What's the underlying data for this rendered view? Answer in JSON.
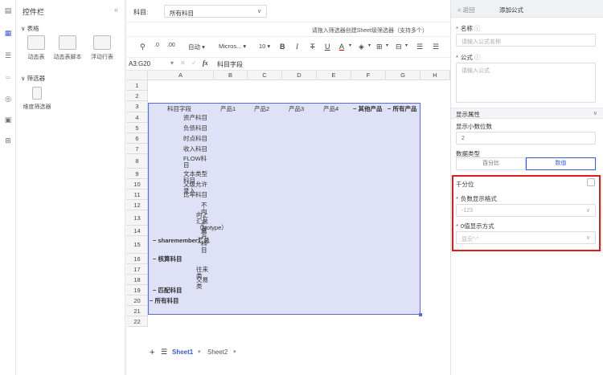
{
  "rail": {
    "icons": [
      "table-icon",
      "grid-icon",
      "list-icon",
      "code-icon",
      "settings-icon",
      "image-icon",
      "tree-icon"
    ]
  },
  "panel": {
    "title": "控件栏",
    "collapse_glyph": "«",
    "group_table": "表格",
    "widgets": [
      "动态表",
      "动态表脚本",
      "浮动行表"
    ],
    "group_filter": "筛选器",
    "filter_widget": "维度筛选器"
  },
  "filter": {
    "label": "科目:",
    "value": "所有科目",
    "hint": "请拖入筛选器创建Sheet级筛选器（支持多个）"
  },
  "toolbar": {
    "auto": "自动",
    "font": "Micros...",
    "size": "10",
    "bold": "B",
    "italic": "I",
    "strike": "T",
    "underline": "U",
    "fontcolor": "A"
  },
  "formula": {
    "ref": "A3:G20",
    "fx": "fx",
    "value": "科目字段"
  },
  "columns": [
    "A",
    "B",
    "C",
    "D",
    "E",
    "F",
    "G",
    "H"
  ],
  "rows": [
    "1",
    "2",
    "3",
    "4",
    "5",
    "6",
    "7",
    "8",
    "9",
    "10",
    "11",
    "12",
    "13",
    "14",
    "15",
    "16",
    "17",
    "18",
    "19",
    "20",
    "21",
    "22"
  ],
  "header_row": {
    "a": "科目字段",
    "b": "产品1",
    "c": "产品2",
    "d": "产品3",
    "e": "产品4",
    "f": "− 其他产品",
    "g": "− 所有产品"
  },
  "acol": [
    "资产科目",
    "负债科目",
    "时点科目",
    "收入科目",
    "FLOW科目",
    "文本类型科目",
    "父级允许录入",
    "比率科目",
    "不向上汇总",
    "向上汇总（Notype）",
    "资产科目",
    "− sharemember汇总",
    "− 核算科目",
    "往来类",
    "交易类",
    "− 匹配科目",
    "− 所有科目"
  ],
  "tabs": {
    "add": "+",
    "menu": "☰",
    "sheet1": "Sheet1",
    "sheet2": "Sheet2"
  },
  "right": {
    "back": "< 返回",
    "title": "添加公式",
    "name_label": "名称",
    "name_placeholder": "请输入公式名称",
    "formula_label": "公式",
    "formula_placeholder": "请输入公式",
    "display_section": "显示属性",
    "decimals_label": "显示小数位数",
    "decimals_value": "2",
    "datatype_label": "数据类型",
    "datatype_percent": "百分比",
    "datatype_number": "数值",
    "thousands_label": "千分位",
    "negative_label": "负数显示格式",
    "negative_value": "-123",
    "zero_label": "0值显示方式",
    "zero_value": "显示\"-\""
  },
  "colors": {
    "accent": "#3d5bd9",
    "selection": "#5a6bd6",
    "highlight": "#e01b1b"
  }
}
